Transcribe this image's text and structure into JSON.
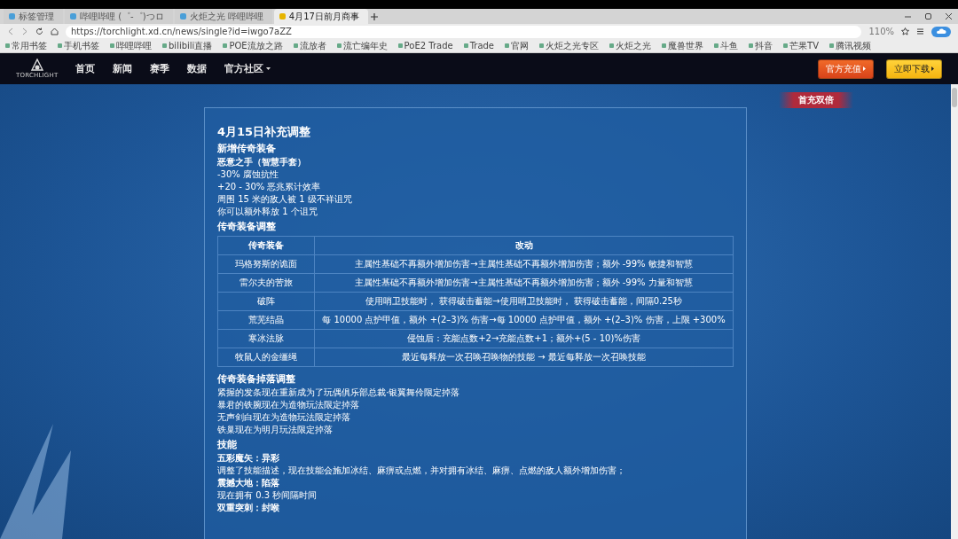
{
  "browser": {
    "tabs": [
      {
        "title": "标签管理",
        "selected": false
      },
      {
        "title": "哔哩哔哩 (゜-゜)つロ",
        "selected": false
      },
      {
        "title": "火炬之光 哔哩哔哩",
        "selected": false
      },
      {
        "title": "4月17日前月商事",
        "selected": true
      }
    ],
    "address": "https://torchlight.xd.cn/news/single?id=iwgo7aZZ",
    "zoom": "110%",
    "bookmarks": [
      "常用书签",
      "手机书签",
      "哔哩哔哩",
      "bilibili直播",
      "POE流放之路",
      "流放者",
      "流亡编年史",
      "PoE2 Trade",
      "Trade",
      "官网",
      "火炬之光专区",
      "火炬之光",
      "魔兽世界",
      "斗鱼",
      "抖音",
      "芒果TV",
      "腾讯视频"
    ]
  },
  "site_nav": {
    "logo_text": "TORCHLIGHT",
    "items": [
      {
        "label": "首页",
        "dropdown": false
      },
      {
        "label": "新闻",
        "dropdown": false
      },
      {
        "label": "赛季",
        "dropdown": false
      },
      {
        "label": "数据",
        "dropdown": false
      },
      {
        "label": "官方社区",
        "dropdown": true
      }
    ],
    "buttons": [
      {
        "label": "官方充值",
        "kind": "recharge"
      },
      {
        "label": "立即下载",
        "kind": "download"
      }
    ],
    "ribbon": "首充双倍"
  },
  "article": {
    "blocks": [
      {
        "kind": "title",
        "text": "4月15日补充调整"
      },
      {
        "kind": "heading",
        "text": "新增传奇装备"
      },
      {
        "kind": "strong",
        "text": "恶意之手（智慧手套）"
      },
      {
        "kind": "text",
        "text": "-30% 腐蚀抗性"
      },
      {
        "kind": "text",
        "text": "+20 - 30% 恶兆累计效率"
      },
      {
        "kind": "text",
        "text": "周围 15 米的敌人被 1 级不祥诅咒"
      },
      {
        "kind": "text",
        "text": "你可以额外释放 1 个诅咒"
      },
      {
        "kind": "heading",
        "text": "传奇装备调整"
      },
      {
        "kind": "table",
        "columns": [
          "传奇装备",
          "改动"
        ],
        "rows": [
          [
            "玛格努斯的诡面",
            "主属性基础不再额外增加伤害→主属性基础不再额外增加伤害；额外 -99% 敏捷和智慧"
          ],
          [
            "雷尔夫的苦旅",
            "主属性基础不再额外增加伤害→主属性基础不再额外增加伤害；额外 -99% 力量和智慧"
          ],
          [
            "破阵",
            "使用哨卫技能时， 获得破击蓄能→使用哨卫技能时， 获得破击蓄能，间隔0.25秒"
          ],
          [
            "荒芜结晶",
            "每 10000 点护甲值，额外 +(2–3)% 伤害→每 10000 点护甲值，额外 +(2–3)% 伤害，上限 +300%"
          ],
          [
            "寒冰法脉",
            "侵蚀后：充能点数+2→充能点数+1；额外+(5 - 10)%伤害"
          ],
          [
            "牧鼠人的金缰绳",
            "最近每释放一次召唤召唤物的技能 → 最近每释放一次召唤技能"
          ]
        ]
      },
      {
        "kind": "heading",
        "text": "传奇装备掉落调整"
      },
      {
        "kind": "text",
        "text": "紧握的发条现在重新成为了玩偶俱乐部总裁·银翼舞伶限定掉落"
      },
      {
        "kind": "text",
        "text": "暴君的铁腕现在为造物玩法限定掉落"
      },
      {
        "kind": "text",
        "text": "无声剑白现在为造物玩法限定掉落"
      },
      {
        "kind": "text",
        "text": "铁巢现在为明月玩法限定掉落"
      },
      {
        "kind": "heading",
        "text": "技能"
      },
      {
        "kind": "strong",
        "text": "五彩魔矢：异彩"
      },
      {
        "kind": "text",
        "text": "调整了技能描述，现在技能会施加冰结、麻痹或点燃，并对拥有冰结、麻痹、点燃的敌人额外增加伤害；"
      },
      {
        "kind": "strong",
        "text": "震撼大地：陷落"
      },
      {
        "kind": "text",
        "text": "现在拥有 0.3 秒间隔时间"
      },
      {
        "kind": "strong",
        "text": "双重突刺：封喉"
      }
    ]
  }
}
